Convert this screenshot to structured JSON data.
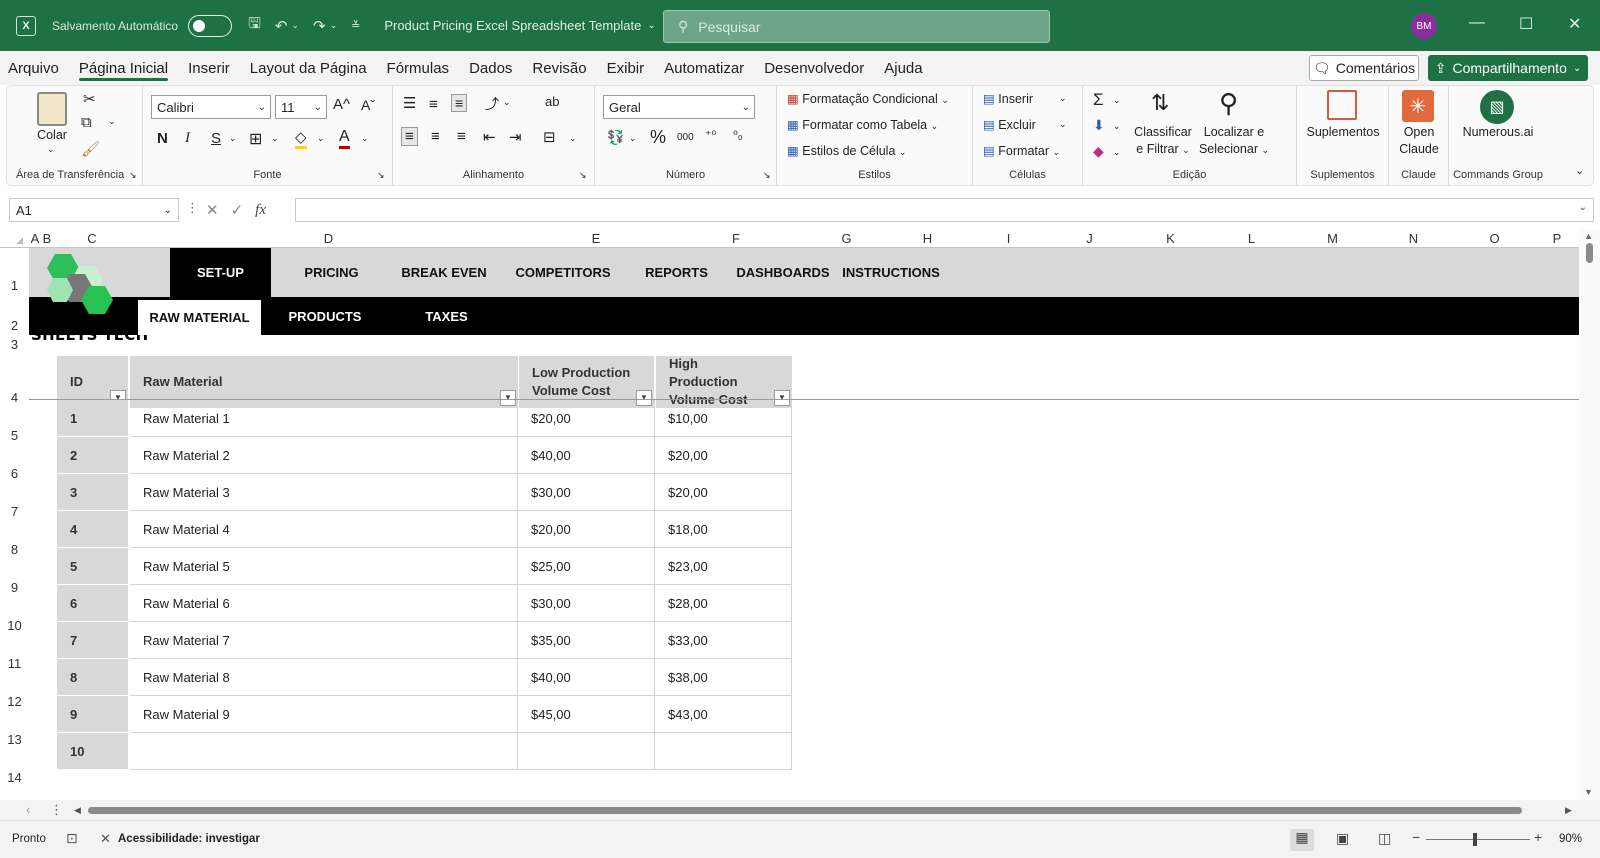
{
  "titlebar": {
    "autosave_label": "Salvamento Automático",
    "document_title": "Product Pricing Excel Spreadsheet Template",
    "search_placeholder": "Pesquisar",
    "user_initials": "BM",
    "accent_color": "#1e7145"
  },
  "menu": {
    "tabs": [
      "Arquivo",
      "Página Inicial",
      "Inserir",
      "Layout da Página",
      "Fórmulas",
      "Dados",
      "Revisão",
      "Exibir",
      "Automatizar",
      "Desenvolvedor",
      "Ajuda"
    ],
    "active_tab": "Página Inicial",
    "comments_label": "Comentários",
    "share_label": "Compartilhamento"
  },
  "ribbon": {
    "clipboard": {
      "paste_label": "Colar",
      "group_label": "Área de Transferência"
    },
    "font": {
      "font_name": "Calibri",
      "font_size": "11",
      "bold": "N",
      "italic": "I",
      "underline": "S",
      "group_label": "Fonte"
    },
    "alignment": {
      "group_label": "Alinhamento"
    },
    "number": {
      "format": "Geral",
      "group_label": "Número",
      "percent": "%",
      "thousands": "000"
    },
    "styles": {
      "conditional": "Formatação Condicional",
      "as_table": "Formatar como Tabela",
      "cell_styles": "Estilos de Célula",
      "group_label": "Estilos"
    },
    "cells": {
      "insert": "Inserir",
      "delete": "Excluir",
      "format": "Formatar",
      "group_label": "Células"
    },
    "editing": {
      "sort_filter_1": "Classificar",
      "sort_filter_2": "e Filtrar",
      "find_select_1": "Localizar e",
      "find_select_2": "Selecionar",
      "group_label": "Edição"
    },
    "addins": {
      "label": "Suplementos",
      "group_label": "Suplementos"
    },
    "claude": {
      "label_1": "Open",
      "label_2": "Claude",
      "group_label": "Claude"
    },
    "numerous": {
      "label": "Numerous.ai",
      "group_label": "Commands Group"
    }
  },
  "formula_bar": {
    "name_box": "A1",
    "fx": "fx"
  },
  "columns": [
    "A",
    "B",
    "C",
    "D",
    "E",
    "F",
    "G",
    "H",
    "I",
    "J",
    "K",
    "L",
    "M",
    "N",
    "O",
    "P"
  ],
  "rows": [
    "1",
    "2",
    "3",
    "4",
    "5",
    "6",
    "7",
    "8",
    "9",
    "10",
    "11",
    "12",
    "13",
    "14"
  ],
  "sheet": {
    "brand": "SHEETS TECH",
    "nav_tabs": [
      "SET-UP",
      "PRICING",
      "BREAK EVEN",
      "COMPETITORS",
      "REPORTS",
      "DASHBOARDS",
      "INSTRUCTIONS"
    ],
    "active_nav": "SET-UP",
    "sub_tabs": [
      "RAW MATERIAL",
      "PRODUCTS",
      "TAXES"
    ],
    "active_sub": "RAW MATERIAL",
    "table": {
      "headers": [
        "ID",
        "Raw Material",
        "Low Production Volume Cost",
        "High Production Volume Cost"
      ],
      "rows": [
        [
          "1",
          "Raw Material 1",
          "$20,00",
          "$10,00"
        ],
        [
          "2",
          "Raw Material 2",
          "$40,00",
          "$20,00"
        ],
        [
          "3",
          "Raw Material 3",
          "$30,00",
          "$20,00"
        ],
        [
          "4",
          "Raw Material 4",
          "$20,00",
          "$18,00"
        ],
        [
          "5",
          "Raw Material 5",
          "$25,00",
          "$23,00"
        ],
        [
          "6",
          "Raw Material 6",
          "$30,00",
          "$28,00"
        ],
        [
          "7",
          "Raw Material 7",
          "$35,00",
          "$33,00"
        ],
        [
          "8",
          "Raw Material 8",
          "$40,00",
          "$38,00"
        ],
        [
          "9",
          "Raw Material 9",
          "$45,00",
          "$43,00"
        ],
        [
          "10",
          "",
          "",
          ""
        ]
      ]
    }
  },
  "statusbar": {
    "ready": "Pronto",
    "accessibility": "Acessibilidade: investigar",
    "zoom": "90%"
  }
}
